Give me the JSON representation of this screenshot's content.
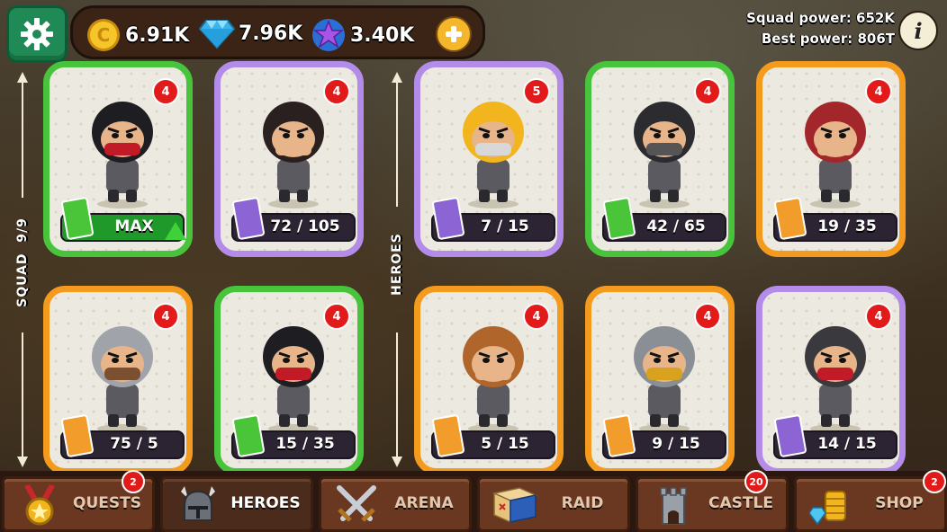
{
  "currencies": [
    {
      "name": "gold",
      "value": "6.91K",
      "icon": "gold-coin-icon",
      "color": "#f2b51e"
    },
    {
      "name": "gems",
      "value": "7.96K",
      "icon": "diamond-icon",
      "color": "#4fc6f2"
    },
    {
      "name": "stars",
      "value": "3.40K",
      "icon": "star-icon",
      "color": "#8d4fd8"
    }
  ],
  "power": {
    "squad": "Squad power: 652K",
    "best": "Best power: 806T"
  },
  "info_label": "i",
  "side": {
    "squad_label": "SQUAD",
    "squad_count": "9/9",
    "heroes_label": "HEROES"
  },
  "cards": [
    {
      "level": "4",
      "progress_text": "MAX",
      "progress": 1.0,
      "rarity": "green",
      "hero": "ninja-red-mask",
      "upgrade": true
    },
    {
      "level": "4",
      "progress_text": "72 / 105",
      "progress": 0.69,
      "rarity": "purple",
      "hero": "bandit"
    },
    {
      "level": "5",
      "progress_text": "7 / 15",
      "progress": 0.47,
      "rarity": "purple",
      "hero": "king"
    },
    {
      "level": "4",
      "progress_text": "42 / 65",
      "progress": 0.65,
      "rarity": "green",
      "hero": "hooded-assassin"
    },
    {
      "level": "4",
      "progress_text": "19 / 35",
      "progress": 0.54,
      "rarity": "orange",
      "hero": "red-hood"
    },
    {
      "level": "4",
      "progress_text": "75 / 5",
      "progress": 0.5,
      "rarity": "orange",
      "hero": "kettle-helm-soldier"
    },
    {
      "level": "4",
      "progress_text": "15 / 35",
      "progress": 0.43,
      "rarity": "green",
      "hero": "red-ninja"
    },
    {
      "level": "4",
      "progress_text": "5 / 15",
      "progress": 0.33,
      "rarity": "orange",
      "hero": "turban-warrior"
    },
    {
      "level": "4",
      "progress_text": "9 / 15",
      "progress": 0.6,
      "rarity": "orange",
      "hero": "armored-knight"
    },
    {
      "level": "4",
      "progress_text": "14 / 15",
      "progress": 0.93,
      "rarity": "purple",
      "hero": "spartan"
    }
  ],
  "nav": [
    {
      "label": "QUESTS",
      "icon": "medal-icon",
      "badge": "2",
      "active": false
    },
    {
      "label": "HEROES",
      "icon": "helmet-icon",
      "badge": "",
      "active": true
    },
    {
      "label": "ARENA",
      "icon": "crossed-swords-icon",
      "badge": "",
      "active": false
    },
    {
      "label": "RAID",
      "icon": "map-icon",
      "badge": "",
      "active": false
    },
    {
      "label": "CASTLE",
      "icon": "castle-tower-icon",
      "badge": "20",
      "active": false
    },
    {
      "label": "SHOP",
      "icon": "coins-stack-icon",
      "badge": "2",
      "active": false
    }
  ]
}
